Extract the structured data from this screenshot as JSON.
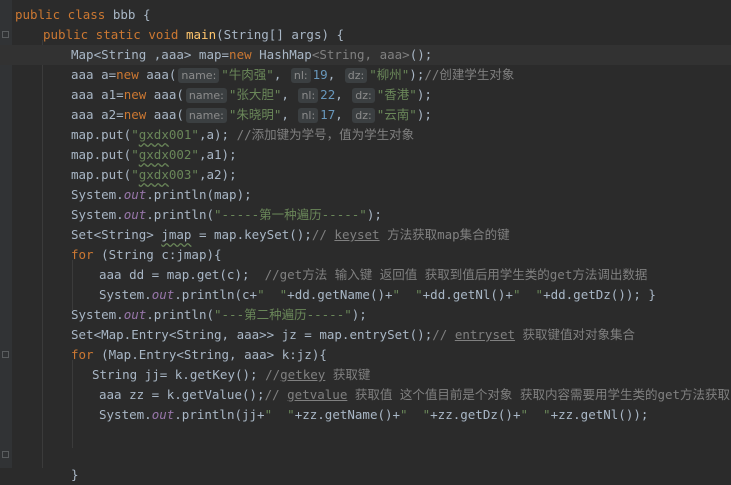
{
  "lines": [
    {
      "indent": 0,
      "parts": [
        {
          "t": "kw",
          "v": "public class "
        },
        {
          "t": "p",
          "v": "bbb {"
        }
      ]
    },
    {
      "indent": 1,
      "parts": [
        {
          "t": "kw",
          "v": "public static void "
        },
        {
          "t": "fn",
          "v": "main"
        },
        {
          "t": "p",
          "v": "(String[] args) {"
        }
      ]
    },
    {
      "indent": 2,
      "current": true,
      "parts": [
        {
          "t": "p",
          "v": "Map<String ,aaa> map="
        },
        {
          "t": "kw",
          "v": "new "
        },
        {
          "t": "p",
          "v": "HashMap"
        },
        {
          "t": "gen",
          "v": "<String, aaa>"
        },
        {
          "t": "p",
          "v": "();"
        }
      ]
    },
    {
      "indent": 2,
      "parts": [
        {
          "t": "p",
          "v": "aaa a="
        },
        {
          "t": "kw",
          "v": "new "
        },
        {
          "t": "p",
          "v": "aaa("
        },
        {
          "t": "hint",
          "v": "name:"
        },
        {
          "t": "str",
          "v": "\"牛肉强\""
        },
        {
          "t": "p",
          "v": ", "
        },
        {
          "t": "hint",
          "v": "nl:"
        },
        {
          "t": "num",
          "v": "19"
        },
        {
          "t": "p",
          "v": ", "
        },
        {
          "t": "hint",
          "v": "dz:"
        },
        {
          "t": "str",
          "v": "\"柳州\""
        },
        {
          "t": "p",
          "v": ");"
        },
        {
          "t": "cmt",
          "v": "//创建学生对象"
        }
      ]
    },
    {
      "indent": 2,
      "parts": [
        {
          "t": "p",
          "v": "aaa a1="
        },
        {
          "t": "kw",
          "v": "new "
        },
        {
          "t": "p",
          "v": "aaa("
        },
        {
          "t": "hint",
          "v": "name:"
        },
        {
          "t": "str",
          "v": "\"张大胆\""
        },
        {
          "t": "p",
          "v": ", "
        },
        {
          "t": "hint",
          "v": "nl:"
        },
        {
          "t": "num",
          "v": "22"
        },
        {
          "t": "p",
          "v": ", "
        },
        {
          "t": "hint",
          "v": "dz:"
        },
        {
          "t": "str",
          "v": "\"香港\""
        },
        {
          "t": "p",
          "v": ");"
        }
      ]
    },
    {
      "indent": 2,
      "parts": [
        {
          "t": "p",
          "v": "aaa a2="
        },
        {
          "t": "kw",
          "v": "new "
        },
        {
          "t": "p",
          "v": "aaa("
        },
        {
          "t": "hint",
          "v": "name:"
        },
        {
          "t": "str",
          "v": "\"朱晓明\""
        },
        {
          "t": "p",
          "v": ", "
        },
        {
          "t": "hint",
          "v": "nl:"
        },
        {
          "t": "num",
          "v": "17"
        },
        {
          "t": "p",
          "v": ", "
        },
        {
          "t": "hint",
          "v": "dz:"
        },
        {
          "t": "str",
          "v": "\"云南\""
        },
        {
          "t": "p",
          "v": ");"
        }
      ]
    },
    {
      "indent": 2,
      "parts": [
        {
          "t": "p",
          "v": "map.put("
        },
        {
          "t": "str",
          "v": "\""
        },
        {
          "t": "strsq",
          "v": "gxdx"
        },
        {
          "t": "str",
          "v": "001\""
        },
        {
          "t": "p",
          "v": ",a); "
        },
        {
          "t": "cmt",
          "v": "//添加键为学号，值为学生对象"
        }
      ]
    },
    {
      "indent": 2,
      "parts": [
        {
          "t": "p",
          "v": "map.put("
        },
        {
          "t": "str",
          "v": "\""
        },
        {
          "t": "strsq",
          "v": "gxdx"
        },
        {
          "t": "str",
          "v": "002\""
        },
        {
          "t": "p",
          "v": ",a1);"
        }
      ]
    },
    {
      "indent": 2,
      "parts": [
        {
          "t": "p",
          "v": "map.put("
        },
        {
          "t": "str",
          "v": "\""
        },
        {
          "t": "strsq",
          "v": "gxdx"
        },
        {
          "t": "str",
          "v": "003\""
        },
        {
          "t": "p",
          "v": ",a2);"
        }
      ]
    },
    {
      "indent": 2,
      "parts": [
        {
          "t": "p",
          "v": "System."
        },
        {
          "t": "stat",
          "v": "out"
        },
        {
          "t": "p",
          "v": ".println(map);"
        }
      ]
    },
    {
      "indent": 2,
      "parts": [
        {
          "t": "p",
          "v": "System."
        },
        {
          "t": "stat",
          "v": "out"
        },
        {
          "t": "p",
          "v": ".println("
        },
        {
          "t": "str",
          "v": "\"-----第一种遍历-----\""
        },
        {
          "t": "p",
          "v": ");"
        }
      ]
    },
    {
      "indent": 2,
      "parts": [
        {
          "t": "p",
          "v": "Set<String> "
        },
        {
          "t": "psq",
          "v": "jmap"
        },
        {
          "t": "p",
          "v": " = map.keySet();"
        },
        {
          "t": "cmt",
          "v": "// "
        },
        {
          "t": "cmtsq",
          "v": "keyset"
        },
        {
          "t": "cmt",
          "v": " 方法获取map集合的键"
        }
      ]
    },
    {
      "indent": 2,
      "parts": [
        {
          "t": "kw",
          "v": "for "
        },
        {
          "t": "p",
          "v": "(String c:jmap){"
        }
      ]
    },
    {
      "indent": 3,
      "parts": [
        {
          "t": "p",
          "v": "aaa dd = map.get(c);  "
        },
        {
          "t": "cmt",
          "v": "//get方法 输入键 返回值 获取到值后用学生类的get方法调出数据"
        }
      ]
    },
    {
      "indent": 3,
      "parts": [
        {
          "t": "p",
          "v": "System."
        },
        {
          "t": "stat",
          "v": "out"
        },
        {
          "t": "p",
          "v": ".println(c+"
        },
        {
          "t": "str",
          "v": "\"  \""
        },
        {
          "t": "p",
          "v": "+dd.getName()+"
        },
        {
          "t": "str",
          "v": "\"  \""
        },
        {
          "t": "p",
          "v": "+dd.getNl()+"
        },
        {
          "t": "str",
          "v": "\"  \""
        },
        {
          "t": "p",
          "v": "+dd.getDz()); }"
        }
      ]
    },
    {
      "indent": 2,
      "parts": [
        {
          "t": "p",
          "v": "System."
        },
        {
          "t": "stat",
          "v": "out"
        },
        {
          "t": "p",
          "v": ".println("
        },
        {
          "t": "str",
          "v": "\"---第二种遍历-----\""
        },
        {
          "t": "p",
          "v": ");"
        }
      ]
    },
    {
      "indent": 2,
      "parts": [
        {
          "t": "p",
          "v": "Set<Map.Entry<String, aaa>> jz = map.entrySet();"
        },
        {
          "t": "cmt",
          "v": "// "
        },
        {
          "t": "cmtsq",
          "v": "entryset"
        },
        {
          "t": "cmt",
          "v": " 获取键值对对象集合"
        }
      ]
    },
    {
      "indent": 2,
      "parts": [
        {
          "t": "kw",
          "v": "for "
        },
        {
          "t": "p",
          "v": "(Map.Entry<String, aaa> k:jz){"
        }
      ]
    },
    {
      "indent": 2.75,
      "parts": [
        {
          "t": "p",
          "v": "String jj= k.getKey(); "
        },
        {
          "t": "cmt",
          "v": "//"
        },
        {
          "t": "cmtsq",
          "v": "getkey"
        },
        {
          "t": "cmt",
          "v": " 获取键"
        }
      ]
    },
    {
      "indent": 3,
      "parts": [
        {
          "t": "p",
          "v": "aaa zz = k.getValue();"
        },
        {
          "t": "cmt",
          "v": "// "
        },
        {
          "t": "cmtsq",
          "v": "getvalue"
        },
        {
          "t": "cmt",
          "v": " 获取值 这个值目前是个对象 获取内容需要用学生类的get方法获取"
        }
      ]
    },
    {
      "indent": 3,
      "parts": [
        {
          "t": "p",
          "v": "System."
        },
        {
          "t": "stat",
          "v": "out"
        },
        {
          "t": "p",
          "v": ".println(jj+"
        },
        {
          "t": "str",
          "v": "\"  \""
        },
        {
          "t": "p",
          "v": "+zz.getName()+"
        },
        {
          "t": "str",
          "v": "\"  \""
        },
        {
          "t": "p",
          "v": "+zz.getDz()+"
        },
        {
          "t": "str",
          "v": "\"  \""
        },
        {
          "t": "p",
          "v": "+zz.getNl());"
        }
      ]
    },
    {
      "indent": 0,
      "parts": []
    },
    {
      "indent": 0,
      "parts": []
    },
    {
      "indent": 2,
      "parts": [
        {
          "t": "p",
          "v": "}"
        }
      ]
    }
  ]
}
